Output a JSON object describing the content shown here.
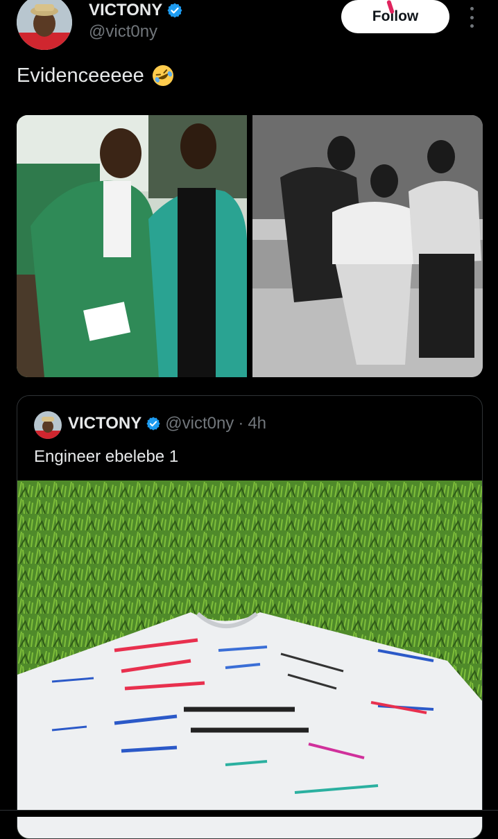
{
  "header": {
    "display_name": "VICTONY",
    "handle": "@vict0ny",
    "follow_label": "Follow",
    "verified_icon": "verified-badge-icon",
    "more_icon": "more-vertical-icon"
  },
  "tweet": {
    "text": "Evidenceeeee",
    "emoji": "rolling-on-floor-laughing-emoji"
  },
  "quote": {
    "display_name": "VICTONY",
    "handle": "@vict0ny",
    "separator": "·",
    "time": "4h",
    "text": "Engineer ebelebe 1"
  },
  "colors": {
    "background": "#000000",
    "text": "#e7e9ea",
    "muted": "#71767b",
    "verified": "#1d9bf0",
    "border": "#2f3336",
    "follow_bg": "#ffffff"
  }
}
